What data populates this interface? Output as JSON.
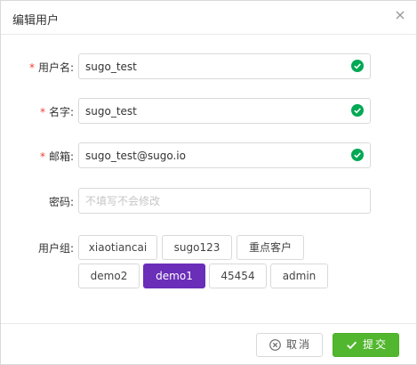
{
  "dialog": {
    "title": "编辑用户",
    "close_icon": "close-icon"
  },
  "form": {
    "required_mark": "*",
    "username": {
      "label": "用户名:",
      "value": "sugo_test",
      "status": "valid"
    },
    "name": {
      "label": "名字:",
      "value": "sugo_test",
      "status": "valid"
    },
    "email": {
      "label": "邮箱:",
      "value": "sugo_test@sugo.io",
      "status": "valid"
    },
    "password": {
      "label": "密码:",
      "value": "",
      "placeholder": "不填写不会修改"
    },
    "groups_label": "用户组:",
    "groups": [
      {
        "label": "xiaotiancai",
        "selected": false
      },
      {
        "label": "sugo123",
        "selected": false
      },
      {
        "label": "重点客户",
        "selected": false
      },
      {
        "label": "demo2",
        "selected": false
      },
      {
        "label": "demo1",
        "selected": true
      },
      {
        "label": "45454",
        "selected": false
      },
      {
        "label": "admin",
        "selected": false
      }
    ]
  },
  "footer": {
    "cancel_label": "取消",
    "submit_label": "提交"
  },
  "colors": {
    "accent": "#6a2eb8",
    "success": "#00a854",
    "submit": "#52b72e",
    "required": "#f04134"
  }
}
